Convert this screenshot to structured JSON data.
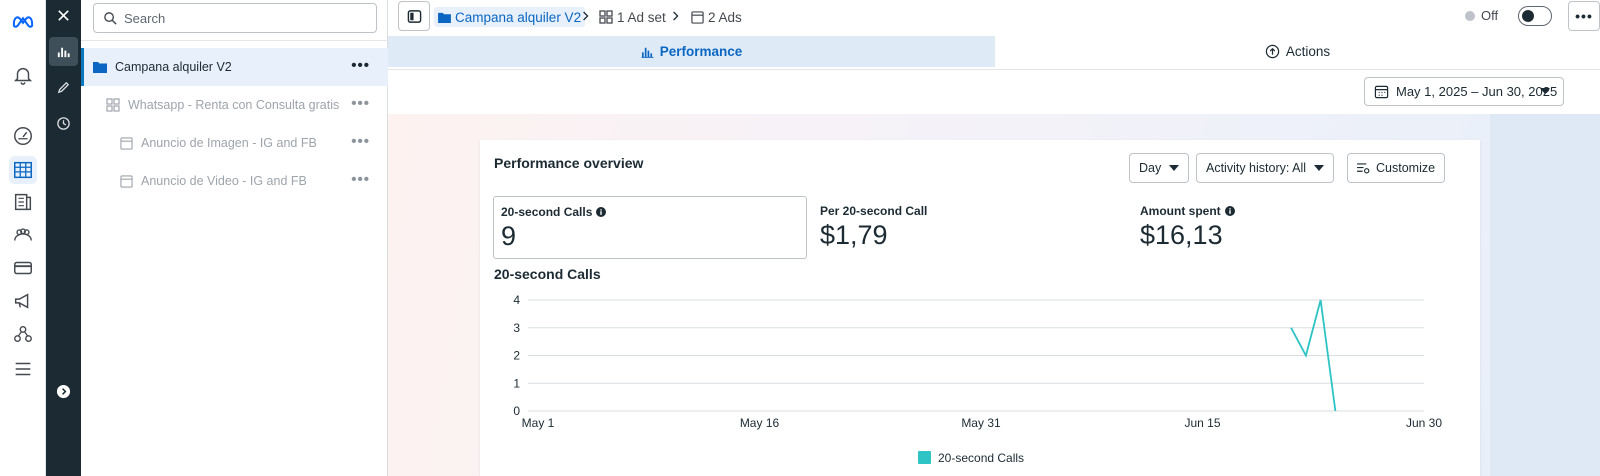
{
  "colors": {
    "accent": "#0a66c2",
    "sidebar_dark": "#1c2b33",
    "series": "#2ec4c6"
  },
  "app_rail": {
    "items": [
      {
        "icon": "meta-logo-icon"
      },
      {
        "icon": "bell-icon"
      },
      {
        "icon": "speedometer-icon"
      },
      {
        "icon": "table-grid-icon",
        "active": true
      },
      {
        "icon": "book-icon"
      },
      {
        "icon": "people-icon"
      },
      {
        "icon": "credit-card-icon"
      },
      {
        "icon": "megaphone-icon"
      },
      {
        "icon": "network-icon"
      },
      {
        "icon": "menu-icon"
      }
    ]
  },
  "tool_rail": {
    "items": [
      {
        "icon": "close-icon"
      },
      {
        "icon": "bar-chart-icon",
        "active": true
      },
      {
        "icon": "pencil-icon"
      },
      {
        "icon": "clock-icon"
      },
      {
        "icon": "expand-arrow-icon"
      }
    ]
  },
  "tree": {
    "search_placeholder": "Search",
    "rows": [
      {
        "label": "Campana alquiler V2",
        "icon": "folder-icon",
        "level": 0,
        "selected": true
      },
      {
        "label": "Whatsapp - Renta con Consulta gratis",
        "icon": "adset-grid-icon",
        "level": 1
      },
      {
        "label": "Anuncio de Imagen - IG and FB",
        "icon": "ad-icon",
        "level": 2
      },
      {
        "label": "Anuncio de Video - IG and FB",
        "icon": "ad-icon",
        "level": 2
      }
    ]
  },
  "breadcrumb": {
    "campaign": "Campana alquiler V2",
    "adset": "1 Ad set",
    "ads": "2 Ads"
  },
  "status": {
    "label": "Off"
  },
  "tabs": {
    "performance": "Performance",
    "actions": "Actions"
  },
  "date_range": "May 1, 2025 – Jun 30, 2025",
  "overview": {
    "title": "Performance overview",
    "granularity": "Day",
    "activity_history": "Activity history: All",
    "customize": "Customize",
    "metrics": [
      {
        "label": "20-second Calls",
        "value": "9",
        "info": true
      },
      {
        "label": "Per 20-second Call",
        "value": "$1,79",
        "info": false
      },
      {
        "label": "Amount spent",
        "value": "$16,13",
        "info": true
      }
    ]
  },
  "chart_data": {
    "type": "line",
    "title": "20-second Calls",
    "x_ticks": [
      "May 1",
      "May 16",
      "May 31",
      "Jun 15",
      "Jun 30"
    ],
    "y_ticks": [
      0,
      1,
      2,
      3,
      4
    ],
    "ylim": [
      0,
      4
    ],
    "xlim": [
      "2025-05-01",
      "2025-06-30"
    ],
    "grid": true,
    "legend": "bottom-center",
    "series": [
      {
        "name": "20-second Calls",
        "color": "#2ec4c6",
        "x": [
          "2025-06-21",
          "2025-06-22",
          "2025-06-23",
          "2025-06-24"
        ],
        "values": [
          3,
          2,
          4,
          0
        ]
      }
    ]
  }
}
